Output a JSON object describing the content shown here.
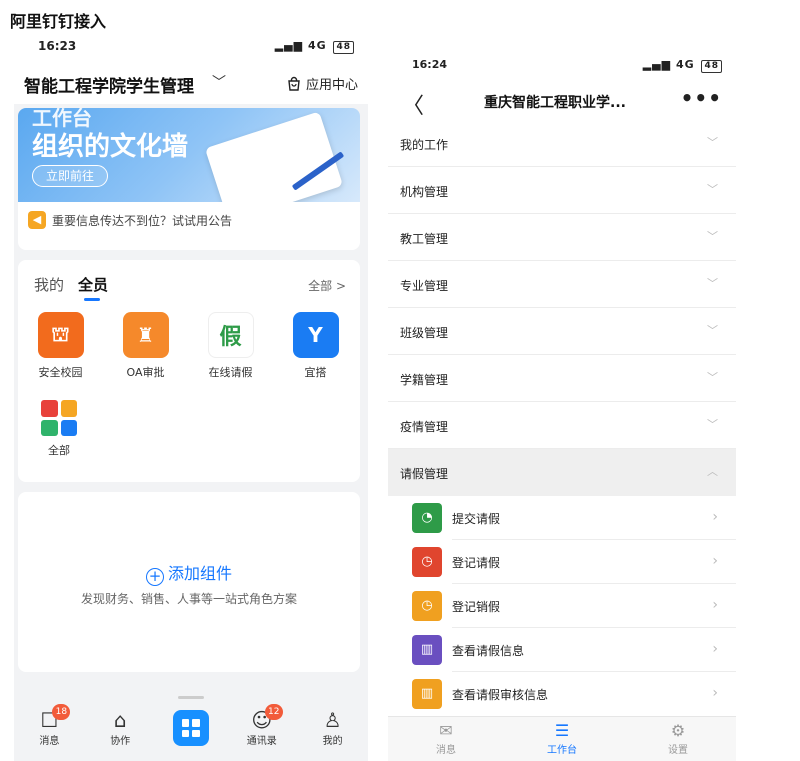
{
  "caption": "阿里钉钉接入",
  "left": {
    "status": {
      "time": "16:23",
      "signal": "4G",
      "battery": "48"
    },
    "header": {
      "org_name": "智能工程学院学生管理",
      "app_center": "应用中心"
    },
    "banner": {
      "tag": "工作台",
      "title": "组织的文化墙",
      "button": "立即前往"
    },
    "notice": "重要信息传达不到位？试试用公告",
    "tabs": {
      "mine": "我的",
      "all_members": "全员",
      "all_link": "全部 >"
    },
    "apps": [
      {
        "label": "安全校园",
        "icon": "campus-icon",
        "glyph": "⛫"
      },
      {
        "label": "OA审批",
        "icon": "stamp-icon",
        "glyph": "♜"
      },
      {
        "label": "在线请假",
        "icon": "leave-icon",
        "glyph": "假"
      },
      {
        "label": "宜搭",
        "icon": "yida-icon",
        "glyph": "Y"
      }
    ],
    "all_apps": "全部",
    "add_widget": {
      "title": "添加组件",
      "subtitle": "发现财务、销售、人事等一站式角色方案"
    },
    "tabbar": [
      {
        "label": "消息",
        "glyph": "☐",
        "badge": "18"
      },
      {
        "label": "协作",
        "glyph": "⌂",
        "badge": ""
      },
      {
        "label": "",
        "glyph": "",
        "badge": ""
      },
      {
        "label": "通讯录",
        "glyph": "☺",
        "badge": "12"
      },
      {
        "label": "我的",
        "glyph": "♙",
        "badge": ""
      }
    ]
  },
  "right": {
    "status": {
      "time": "16:24",
      "signal": "4G",
      "battery": "48"
    },
    "nav": {
      "title": "重庆智能工程职业学...",
      "back": "〈",
      "more": "•••"
    },
    "menu": [
      {
        "label": "我的工作"
      },
      {
        "label": "机构管理"
      },
      {
        "label": "教工管理"
      },
      {
        "label": "专业管理"
      },
      {
        "label": "班级管理"
      },
      {
        "label": "学籍管理"
      },
      {
        "label": "疫情管理"
      }
    ],
    "open_menu": "请假管理",
    "sub_items": [
      {
        "label": "提交请假",
        "color": "#2e9b48",
        "glyph": "◔"
      },
      {
        "label": "登记请假",
        "color": "#e0452e",
        "glyph": "◷"
      },
      {
        "label": "登记销假",
        "color": "#f0a020",
        "glyph": "◷"
      },
      {
        "label": "查看请假信息",
        "color": "#6a4fc0",
        "glyph": "▥"
      },
      {
        "label": "查看请假审核信息",
        "color": "#f0a020",
        "glyph": "▥"
      }
    ],
    "tabbar": [
      {
        "label": "消息",
        "glyph": "✉"
      },
      {
        "label": "工作台",
        "glyph": "☰"
      },
      {
        "label": "设置",
        "glyph": "⚙"
      }
    ]
  }
}
